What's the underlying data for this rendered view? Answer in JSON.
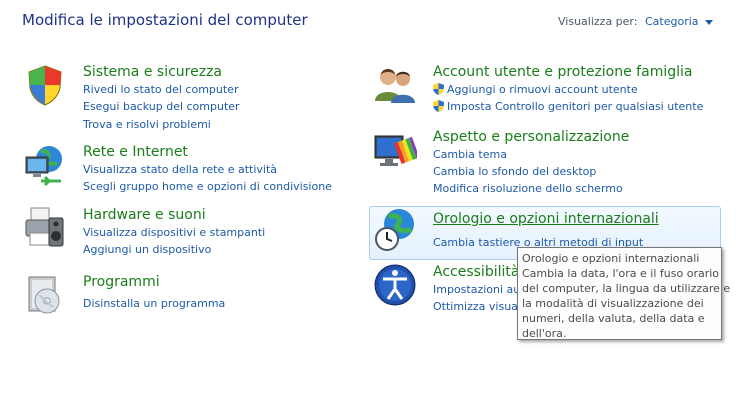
{
  "header": {
    "title": "Modifica le impostazioni del computer",
    "view_label": "Visualizza per:",
    "view_value": "Categoria"
  },
  "categories": [
    {
      "title": "Sistema e sicurezza",
      "icon": "shield-icon",
      "links": [
        "Rivedi lo stato del computer",
        "Esegui backup del computer",
        "Trova e risolvi problemi"
      ]
    },
    {
      "title": "Rete e Internet",
      "icon": "network-globe-icon",
      "links": [
        "Visualizza stato della rete e attività",
        "Scegli gruppo home e opzioni di condivisione"
      ]
    },
    {
      "title": "Hardware e suoni",
      "icon": "printer-speaker-icon",
      "links": [
        "Visualizza dispositivi e stampanti",
        "Aggiungi un dispositivo"
      ]
    },
    {
      "title": "Programmi",
      "icon": "programs-box-icon",
      "links": [
        "Disinstalla un programma"
      ]
    },
    {
      "title": "Account utente e protezione famiglia",
      "icon": "users-icon",
      "links": [
        "Aggiungi o rimuovi account utente",
        "Imposta Controllo genitori per qualsiasi utente"
      ]
    },
    {
      "title": "Aspetto e personalizzazione",
      "icon": "monitor-palette-icon",
      "links": [
        "Cambia tema",
        "Cambia lo sfondo del desktop",
        "Modifica risoluzione dello schermo"
      ]
    },
    {
      "title": "Orologio e opzioni internazionali",
      "icon": "clock-globe-icon",
      "links": [
        "Cambia tastiere o altri metodi di input"
      ]
    },
    {
      "title": "Accessibilità",
      "icon": "accessibility-icon",
      "links": [
        "Impostazioni au",
        "Ottimizza visual"
      ]
    }
  ],
  "tooltip": {
    "lines": [
      "Orologio e opzioni internazionali",
      "Cambia la data, l'ora e il fuso orario",
      "del computer, la lingua da utilizzare e",
      "la modalità di visualizzazione dei",
      "numeri, della valuta, della data e",
      "dell'ora."
    ]
  },
  "colors": {
    "title_green": "#1a7d1a",
    "link_blue": "#1e5aa8",
    "header_blue": "#1e3287"
  }
}
